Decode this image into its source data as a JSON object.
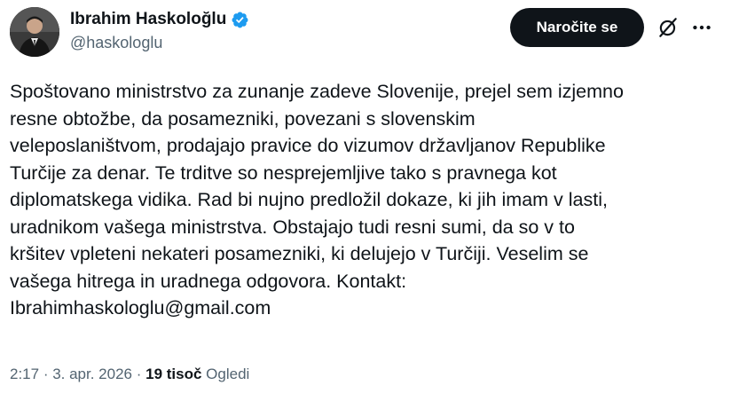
{
  "author": {
    "display_name": "Ibrahim Haskoloğlu",
    "handle": "@haskologlu",
    "verified": true,
    "avatar": "avatar-photo"
  },
  "actions": {
    "follow_label": "Naročite se",
    "grok_icon": "grok-icon",
    "more_icon": "more-dots-icon"
  },
  "tweet": {
    "lines": [
      "Spoštovano ministrstvo za zunanje zadeve Slovenije, prejel sem izjemno",
      "resne obtožbe, da posamezniki, povezani s slovenskim",
      "veleposlaništvom, prodajajo pravice do vizumov državljanov Republike",
      "Turčije za denar. Te trditve so nesprejemljive tako s pravnega kot",
      "diplomatskega vidika. Rad bi nujno predložil dokaze, ki jih imam v lasti,",
      "uradnikom vašega ministrstva. Obstajajo tudi resni sumi, da so v to",
      "kršitev vpleteni nekateri posamezniki, ki delujejo v Turčiji. Veselim se",
      "vašega hitrega in uradnega odgovora. Kontakt:",
      "Ibrahimhaskologlu@gmail.com"
    ]
  },
  "meta": {
    "time": "2:17",
    "separator": " · ",
    "date": "3. apr. 2026",
    "views_count": "19 tisoč",
    "views_label": "Ogledi"
  },
  "colors": {
    "text": "#0f1419",
    "secondary": "#536471",
    "verified": "#1d9bf0",
    "button_bg": "#0f1419",
    "button_text": "#ffffff"
  }
}
